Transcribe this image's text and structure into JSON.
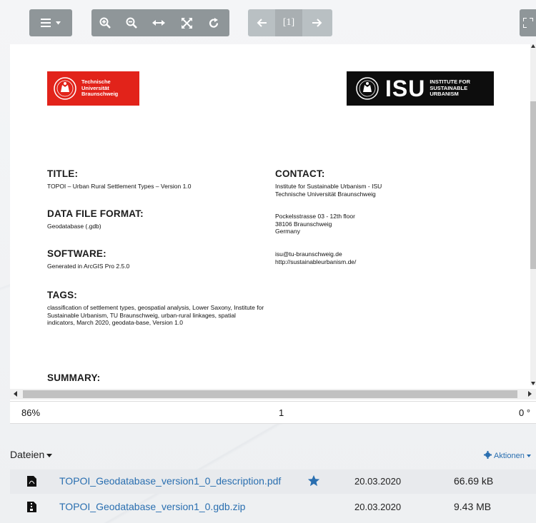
{
  "toolbar": {
    "menu_icon": "hamburger-menu-icon",
    "zoom_in_icon": "zoom-in-icon",
    "zoom_out_icon": "zoom-out-icon",
    "fit_width_icon": "fit-width-icon",
    "fit_page_icon": "fit-page-icon",
    "rotate_icon": "rotate-icon",
    "prev_icon": "arrow-left-icon",
    "page_label": "[1]",
    "next_icon": "arrow-right-icon",
    "fullscreen_icon": "fullscreen-icon"
  },
  "document": {
    "tu_logo_text": [
      "Technische",
      "Universität",
      "Braunschweig"
    ],
    "isu_logo_big": "ISU",
    "isu_logo_small": [
      "INSTITUTE FOR",
      "SUSTAINABLE",
      "URBANISM"
    ],
    "title_heading": "TITLE:",
    "title_text": "TOPOI – Urban Rural Settlement Types – Version 1.0",
    "format_heading": "DATA FILE FORMAT:",
    "format_text": "Geodatabase (.gdb)",
    "software_heading": "SOFTWARE:",
    "software_text": "Generated in ArcGIS Pro 2.5.0",
    "tags_heading": "TAGS:",
    "tags_text": "classification of settlement types, geospatial analysis, Lower Saxony, Institute for Sustainable Urbanism, TU Braunschweig, urban-rural linkages, spatial indicators, March 2020, geodata-base, Version 1.0",
    "summary_heading": "SUMMARY:",
    "contact_heading": "CONTACT:",
    "contact_org": [
      "Institute for Sustainable Urbanism - ISU",
      "Technische Universität Braunschweig"
    ],
    "contact_address": [
      "Pockelsstrasse 03 - 12th floor",
      "38106 Braunschweig",
      "Germany"
    ],
    "contact_web": [
      "isu@tu-braunschweig.de",
      "http://sustainableurbanism.de/"
    ]
  },
  "status": {
    "zoom": "86%",
    "page": "1",
    "rotation": "0 °"
  },
  "files": {
    "title": "Dateien",
    "actions_label": "Aktionen",
    "items": [
      {
        "name": "TOPOI_Geodatabase_version1_0_description.pdf",
        "date": "20.03.2020",
        "size": "66.69 kB",
        "starred": true
      },
      {
        "name": "TOPOI_Geodatabase_version1_0.gdb.zip",
        "date": "20.03.2020",
        "size": "9.43 MB",
        "starred": false
      }
    ]
  },
  "colors": {
    "toolbar": "#8f9699",
    "link": "#2a6fb0",
    "tu_red": "#e2231a",
    "isu_black": "#0d0d0d"
  }
}
